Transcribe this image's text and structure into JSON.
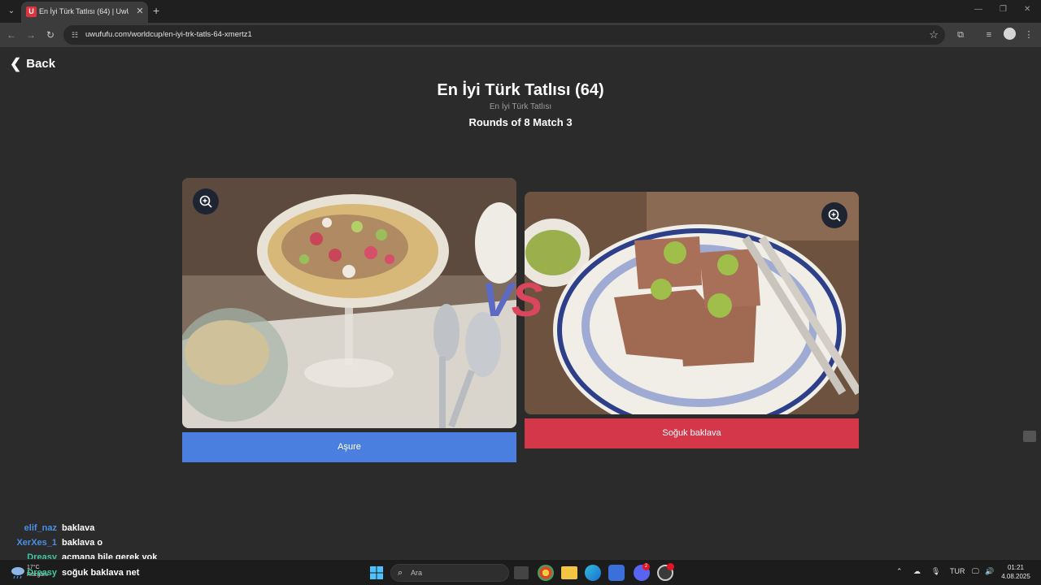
{
  "browser": {
    "tab_title": "En İyi Türk Tatlısı (64) | UwUFUFU",
    "favicon_letter": "U",
    "url": "uwufufu.com/worldcup/en-iyi-trk-tatls-64-xmertz1"
  },
  "page": {
    "back_label": "Back",
    "title": "En İyi Türk Tatlısı (64)",
    "subtitle": "En İyi Türk Tatlısı",
    "round_info": "Rounds of 8 Match 3",
    "vs_v": "V",
    "vs_s": "S"
  },
  "choices": [
    {
      "label": "Aşure",
      "color": "#4a7fe0"
    },
    {
      "label": "Soğuk baklava",
      "color": "#d4374a"
    }
  ],
  "chat": [
    {
      "user": "elif_naz",
      "user_color": "#4a8fe8",
      "message": "baklava"
    },
    {
      "user": "XerXes_1",
      "user_color": "#4a8fe8",
      "message": "baklava o"
    },
    {
      "user": "Dreasy",
      "user_color": "#3ec9a0",
      "message": "açmana bile gerek yok"
    },
    {
      "user": "Dreasy",
      "user_color": "#3ec9a0",
      "message": "soğuk baklava net"
    }
  ],
  "taskbar": {
    "weather_temp": "17°C",
    "weather_desc": "Rüzgârlı",
    "search_placeholder": "Ara",
    "discord_badge": "2",
    "language": "TUR",
    "time": "01:21",
    "date": "4.08.2025"
  }
}
